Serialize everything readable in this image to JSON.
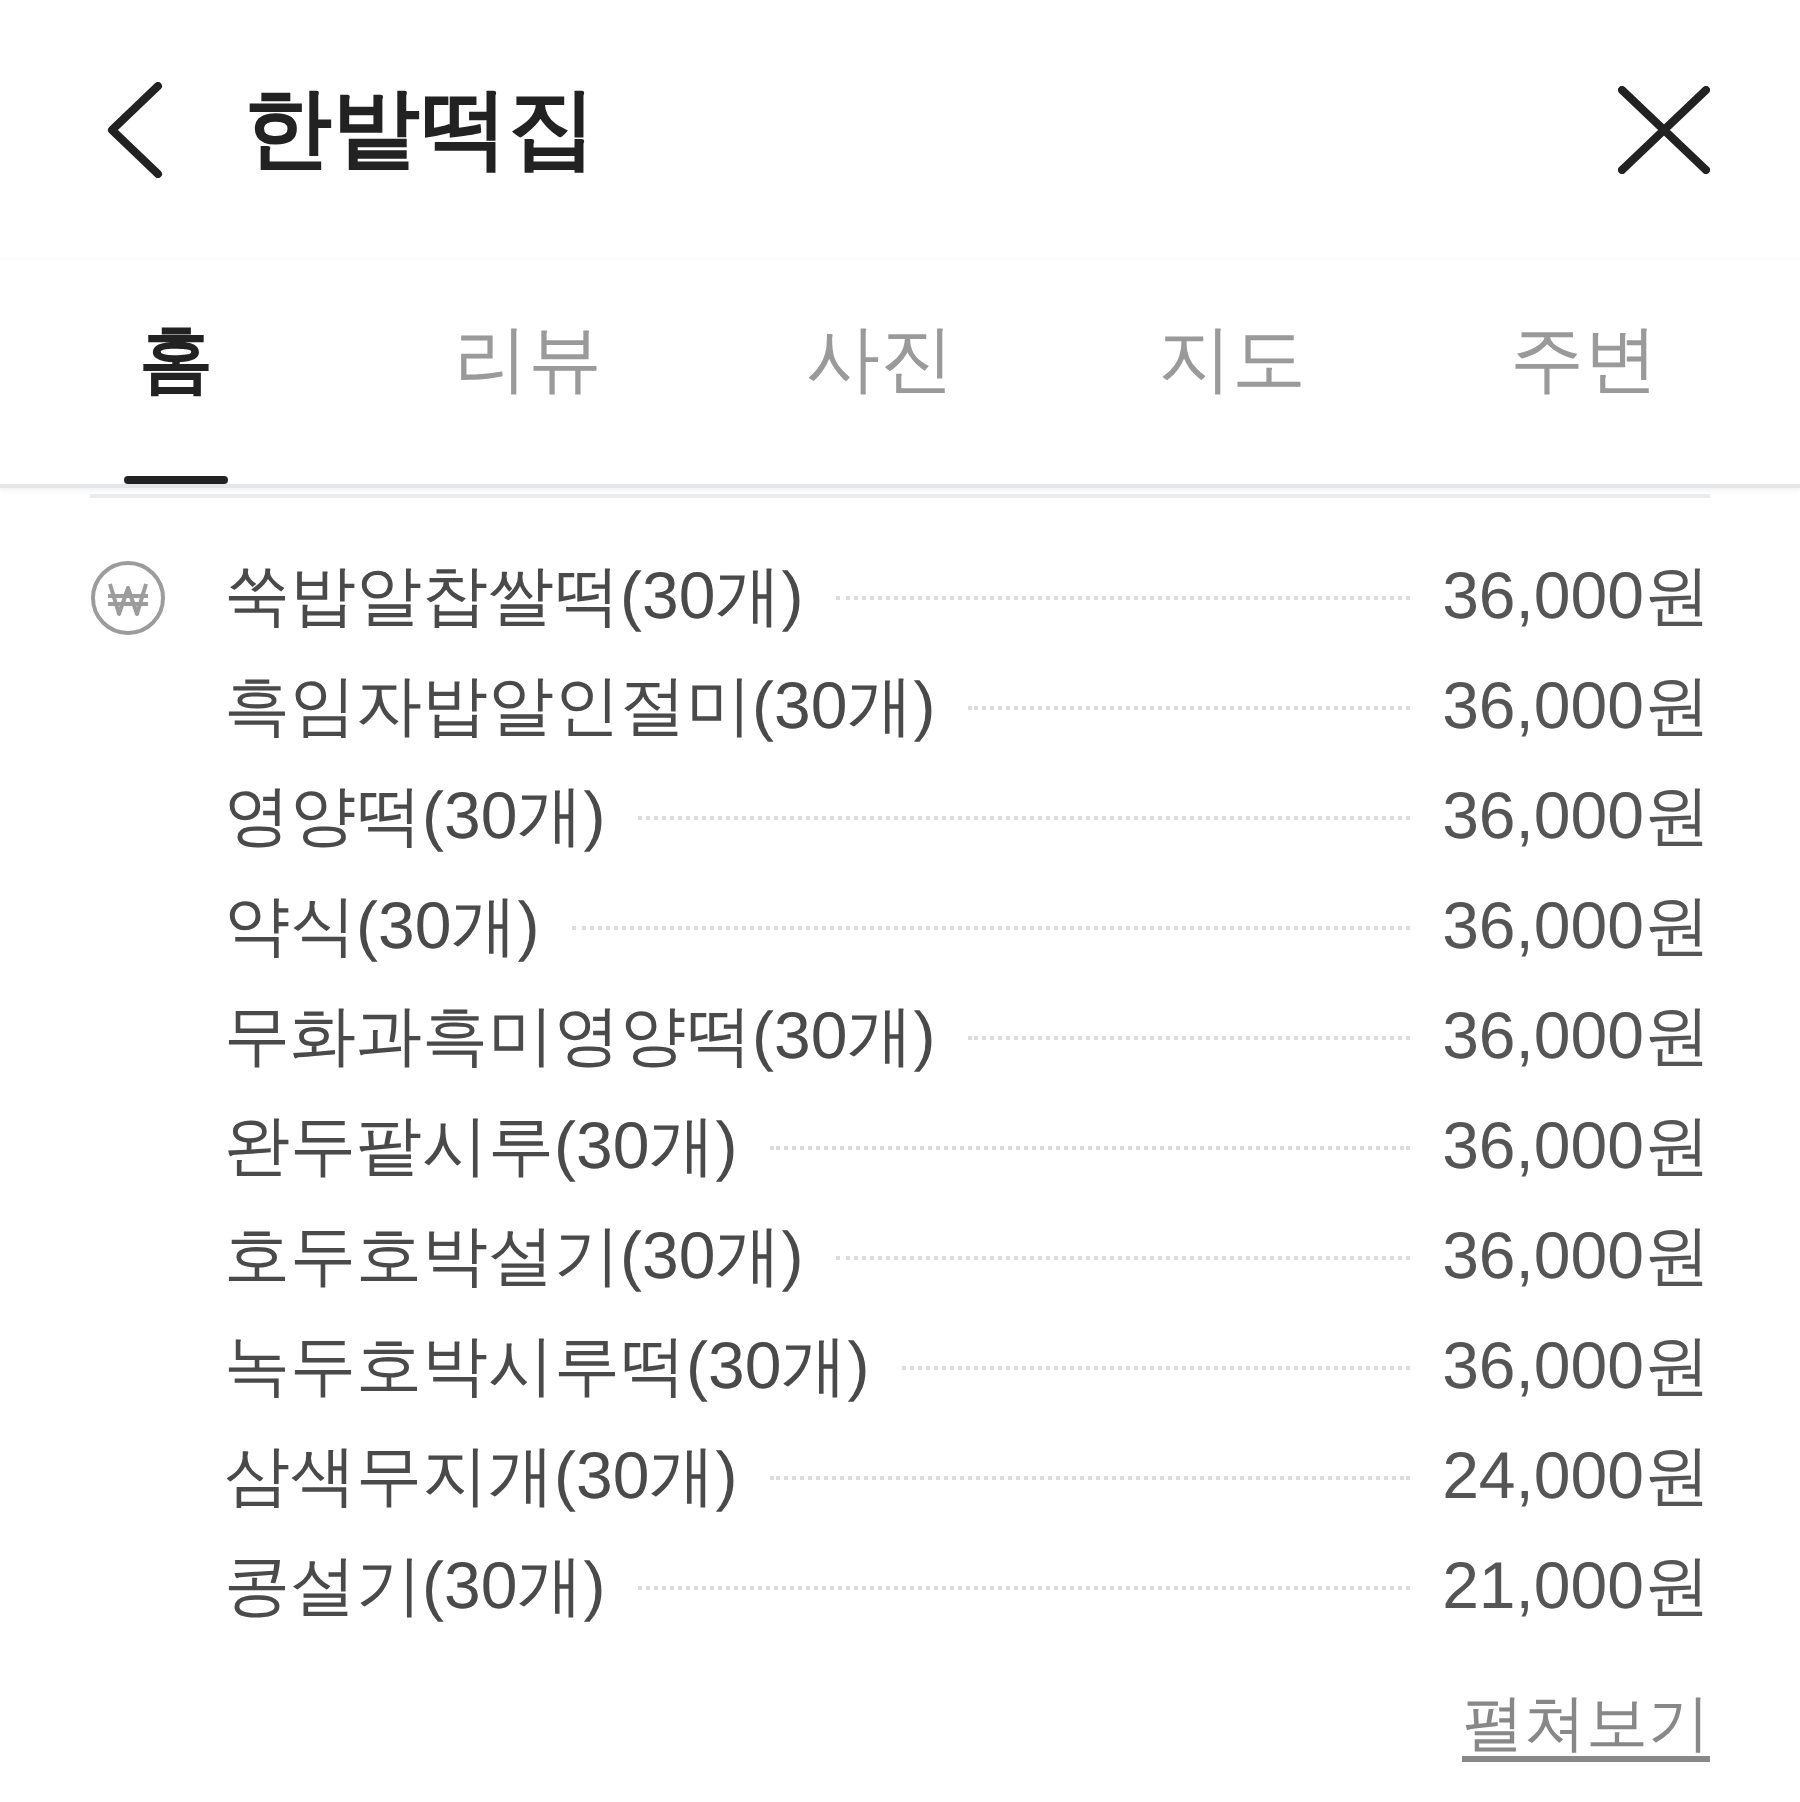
{
  "header": {
    "title": "한밭떡집"
  },
  "tabs": [
    {
      "label": "홈",
      "selected": true
    },
    {
      "label": "리뷰",
      "selected": false
    },
    {
      "label": "사진",
      "selected": false
    },
    {
      "label": "지도",
      "selected": false
    },
    {
      "label": "주변",
      "selected": false
    }
  ],
  "menu": {
    "items": [
      {
        "name": "쑥밥알찹쌀떡(30개)",
        "price": "36,000원"
      },
      {
        "name": "흑임자밥알인절미(30개)",
        "price": "36,000원"
      },
      {
        "name": "영양떡(30개)",
        "price": "36,000원"
      },
      {
        "name": "약식(30개)",
        "price": "36,000원"
      },
      {
        "name": "무화과흑미영양떡(30개)",
        "price": "36,000원"
      },
      {
        "name": "완두팥시루(30개)",
        "price": "36,000원"
      },
      {
        "name": "호두호박설기(30개)",
        "price": "36,000원"
      },
      {
        "name": "녹두호박시루떡(30개)",
        "price": "36,000원"
      },
      {
        "name": "삼색무지개(30개)",
        "price": "24,000원"
      },
      {
        "name": "콩설기(30개)",
        "price": "21,000원"
      }
    ],
    "more_link": "펼쳐보기"
  }
}
